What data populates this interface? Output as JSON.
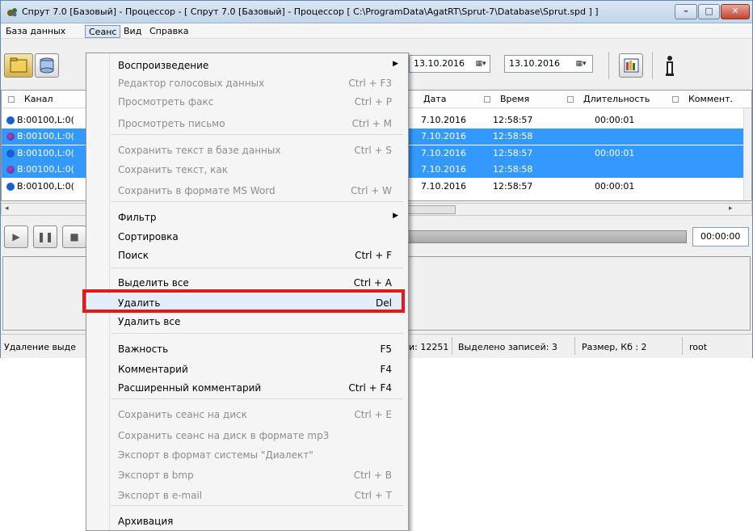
{
  "window": {
    "title": "Спрут 7.0 [Базовый] - Процессор - [ Спрут 7.0 [Базовый] - Процессор [ C:\\ProgramData\\AgatRT\\Sprut-7\\Database\\Sprut.spd ] ]"
  },
  "menubar": {
    "items": [
      "База данных",
      "Сеанс",
      "Вид",
      "Справка"
    ]
  },
  "toolbar": {
    "date_from": "13.10.2016",
    "date_sep": "-",
    "date_to": "13.10.2016"
  },
  "grid": {
    "columns": [
      "Канал",
      "Дата",
      "Время",
      "Длительность",
      "Коммент."
    ],
    "rows": [
      {
        "channel": "B:00100,L:0(",
        "date": "7.10.2016",
        "time": "12:58:57",
        "duration": "00:00:01",
        "selected": false
      },
      {
        "channel": "B:00100,L:0(",
        "date": "7.10.2016",
        "time": "12:58:58",
        "duration": "",
        "selected": true
      },
      {
        "channel": "B:00100,L:0(",
        "date": "7.10.2016",
        "time": "12:58:57",
        "duration": "00:00:01",
        "selected": true
      },
      {
        "channel": "B:00100,L:0(",
        "date": "7.10.2016",
        "time": "12:58:58",
        "duration": "",
        "selected": true
      },
      {
        "channel": "B:00100,L:0(",
        "date": "7.10.2016",
        "time": "12:58:57",
        "duration": "00:00:01",
        "selected": false
      }
    ]
  },
  "player": {
    "time": "00:00:00"
  },
  "status": {
    "action": "Удаление выде",
    "records": "и: 12251",
    "selected": "Выделено записей: 3",
    "size": "Размер, Кб : 2",
    "user": "root"
  },
  "menu": {
    "items": [
      {
        "label": "Воспроизведение",
        "shortcut": "",
        "submenu": true,
        "disabled": false
      },
      {
        "label": "Редактор голосовых данных",
        "shortcut": "Ctrl + F3",
        "disabled": true
      },
      {
        "label": "Просмотреть факс",
        "shortcut": "Ctrl + P",
        "disabled": true
      },
      {
        "label": "Просмотреть письмо",
        "shortcut": "Ctrl + M",
        "disabled": true
      },
      {
        "label": "Сохранить текст в базе данных",
        "shortcut": "Ctrl + S",
        "disabled": true
      },
      {
        "label": "Сохранить текст, как",
        "shortcut": "",
        "disabled": true
      },
      {
        "label": "Сохранить в формате MS Word",
        "shortcut": "Ctrl + W",
        "disabled": true
      },
      {
        "label": "Фильтр",
        "shortcut": "",
        "submenu": true,
        "disabled": false
      },
      {
        "label": "Сортировка",
        "shortcut": "",
        "disabled": false
      },
      {
        "label": "Поиск",
        "shortcut": "Ctrl + F",
        "disabled": false
      },
      {
        "label": "Выделить все",
        "shortcut": "Ctrl + A",
        "disabled": false
      },
      {
        "label": "Удалить",
        "shortcut": "Del",
        "disabled": false
      },
      {
        "label": "Удалить все",
        "shortcut": "",
        "disabled": false
      },
      {
        "label": "Важность",
        "shortcut": "F5",
        "disabled": false
      },
      {
        "label": "Комментарий",
        "shortcut": "F4",
        "disabled": false
      },
      {
        "label": "Расширенный комментарий",
        "shortcut": "Ctrl + F4",
        "disabled": false
      },
      {
        "label": "Сохранить сеанс на диск",
        "shortcut": "Ctrl + E",
        "disabled": true
      },
      {
        "label": "Сохранить сеанс на диск в формате mp3",
        "shortcut": "",
        "disabled": true
      },
      {
        "label": "Экспорт в формат системы \"Диалект\"",
        "shortcut": "",
        "disabled": true
      },
      {
        "label": "Экспорт в bmp",
        "shortcut": "Ctrl + B",
        "disabled": true
      },
      {
        "label": "Экспорт в e-mail",
        "shortcut": "Ctrl + T",
        "disabled": true
      },
      {
        "label": "Архивация",
        "shortcut": "",
        "disabled": false
      }
    ]
  }
}
